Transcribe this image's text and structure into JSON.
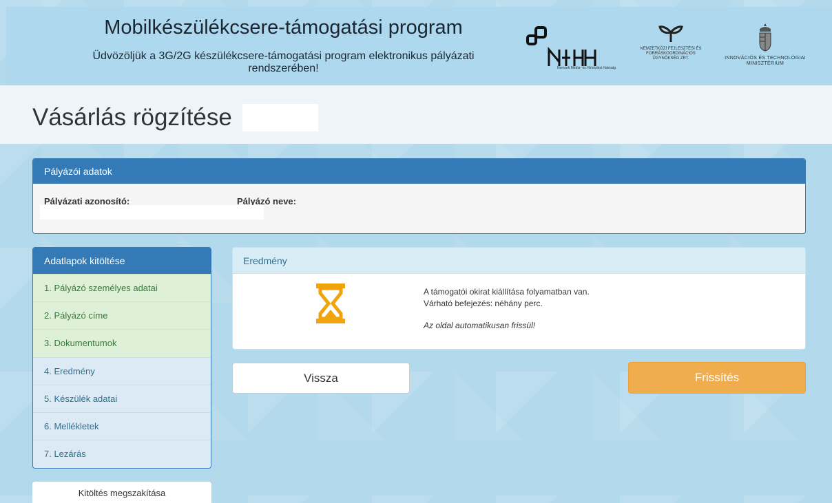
{
  "header": {
    "title": "Mobilkészülékcsere-támogatási program",
    "subtitle_line1": "Üdvözöljük a 3G/2G készülékcsere-támogatási program elektronikus pályázati",
    "subtitle_line2": "rendszerében!",
    "logos": {
      "nmhh_text": "NMHH",
      "nmhh_sub": "Nemzeti Média- és Hírközlési Hatóság",
      "nfu_line1": "NEMZETKÖZI FEJLESZTÉSI ÉS",
      "nfu_line2": "FORRÁSKOORDINÁCIÓS",
      "nfu_line3": "ÜGYNÖKSÉG ZRT.",
      "itm_line1": "INNOVÁCIÓS ÉS TECHNOLÓGIAI",
      "itm_line2": "MINISZTÉRIUM"
    }
  },
  "page": {
    "title": "Vásárlás rögzítése"
  },
  "applicant_panel": {
    "heading": "Pályázói adatok",
    "id_label": "Pályázati azonosító:",
    "name_label": "Pályázó neve:"
  },
  "nav": {
    "heading": "Adatlapok kitöltése",
    "items": [
      {
        "label": "1. Pályázó személyes adatai",
        "state": "done"
      },
      {
        "label": "2. Pályázó címe",
        "state": "done"
      },
      {
        "label": "3. Dokumentumok",
        "state": "done"
      },
      {
        "label": "4. Eredmény",
        "state": "todo"
      },
      {
        "label": "5. Készülék adatai",
        "state": "todo"
      },
      {
        "label": "6. Mellékletek",
        "state": "todo"
      },
      {
        "label": "7. Lezárás",
        "state": "todo"
      }
    ],
    "abort_label": "Kitöltés megszakítása"
  },
  "result": {
    "heading": "Eredmény",
    "icon": "hourglass-icon",
    "line1": "A támogatói okirat kiállítása folyamatban van.",
    "line2": "Várható befejezés: néhány perc.",
    "note": "Az oldal automatikusan frissül!"
  },
  "actions": {
    "back_label": "Vissza",
    "refresh_label": "Frissítés"
  },
  "colors": {
    "primary": "#337ab7",
    "warning": "#f0ad4e",
    "info_bg": "#d9edf7",
    "success_bg": "#dff0d8",
    "icon_orange": "#f0a30a"
  }
}
